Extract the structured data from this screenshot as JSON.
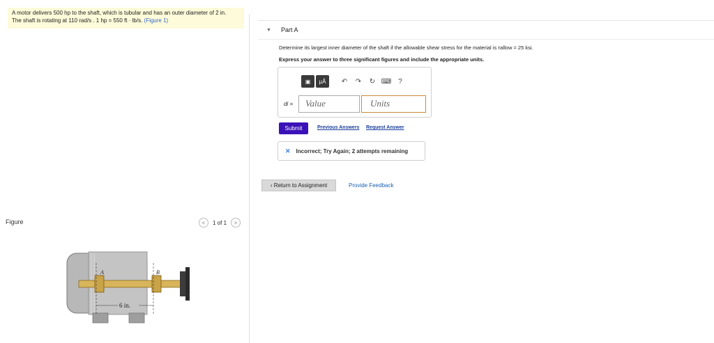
{
  "problem": {
    "line1": "A motor delivers 500 hp to the shaft, which is tubular and has an outer diameter of 2 in.",
    "line2_prefix": "The shaft is rotating at 110 rad/s . 1 hp = 550 ft · lb/s.",
    "figure_link": "(Figure 1)"
  },
  "figure_panel": {
    "label": "Figure",
    "pager": "1 of 1",
    "prev_glyph": "<",
    "next_glyph": ">",
    "label_a": "A",
    "label_b": "B",
    "dimension": "6 in."
  },
  "part": {
    "toggle_glyph": "▼",
    "title": "Part A",
    "question": "Determine its largest inner diameter of the shaft if the allowable shear stress for the material is τallow = 25 ksi.",
    "instruction": "Express your answer to three significant figures and include the appropriate units."
  },
  "toolbar": {
    "templates_glyph": "▣",
    "units_label": "μÅ",
    "undo_glyph": "↶",
    "redo_glyph": "↷",
    "reset_glyph": "↻",
    "keyboard_glyph": "⌨",
    "help_glyph": "?"
  },
  "answer": {
    "var_label": "di =",
    "value_placeholder": "Value",
    "units_placeholder": "Units"
  },
  "actions": {
    "submit": "Submit",
    "previous": "Previous Answers",
    "request": "Request Answer"
  },
  "feedback_msg": {
    "icon": "✕",
    "text": "Incorrect; Try Again; 2 attempts remaining"
  },
  "footer": {
    "return": "‹ Return to Assignment",
    "provide_feedback": "Provide Feedback"
  }
}
